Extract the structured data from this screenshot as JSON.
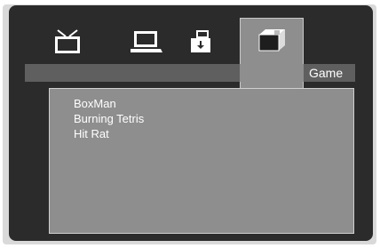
{
  "menu": {
    "tabs": [
      {
        "id": "tv",
        "icon": "tv-icon"
      },
      {
        "id": "pc",
        "icon": "laptop-icon"
      },
      {
        "id": "usb",
        "icon": "usb-drive-icon"
      },
      {
        "id": "game",
        "icon": "game-box-icon",
        "selected": true
      }
    ],
    "section_title": "Game"
  },
  "game_list": {
    "items": [
      "BoxMan",
      "Burning Tetris",
      "Hit Rat"
    ]
  },
  "colors": {
    "panel_bg": "#2b2b2b",
    "selected_bg": "#8e8e8e",
    "title_bar": "#5f5f5f",
    "text": "#ffffff"
  }
}
